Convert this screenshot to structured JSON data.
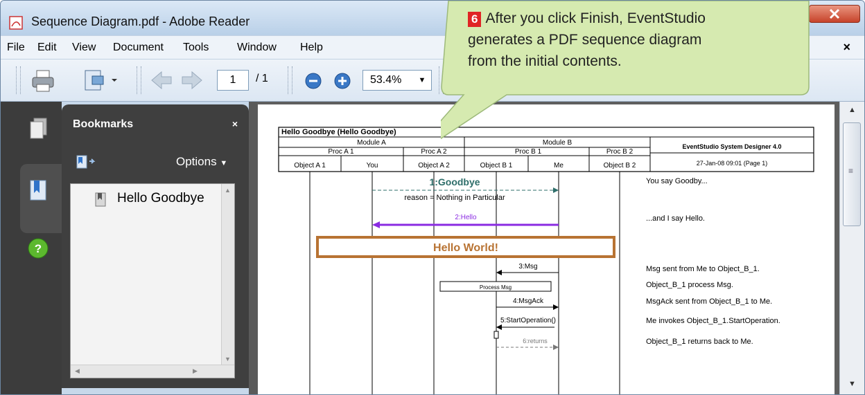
{
  "window": {
    "title": "Sequence Diagram.pdf - Adobe Reader"
  },
  "menu": {
    "items": [
      "File",
      "Edit",
      "View",
      "Document",
      "Tools",
      "Window",
      "Help"
    ],
    "close": "×"
  },
  "toolbar": {
    "page_current": "1",
    "page_total": "/ 1",
    "zoom": "53.4%"
  },
  "bookmarks": {
    "title": "Bookmarks",
    "close": "×",
    "options": "Options",
    "items": [
      "Hello Goodbye"
    ]
  },
  "callout": {
    "step": "6",
    "text": "After you click Finish, EventStudio generates a PDF sequence diagram from the initial contents."
  },
  "diagram": {
    "title": "Hello Goodbye (Hello Goodbye)",
    "modules": [
      "Module A",
      "Module B"
    ],
    "procs": [
      "Proc A 1",
      "Proc A 2",
      "Proc B 1",
      "Proc B 2"
    ],
    "objects": [
      "Object A 1",
      "You",
      "Object A 2",
      "Object B 1",
      "Me",
      "Object B 2"
    ],
    "tool": "EventStudio System Designer 4.0",
    "date": "27-Jan-08 09:01 (Page 1)",
    "messages": {
      "goodbye": "1:Goodbye",
      "reason": "reason = Nothing in Particular",
      "hello": "2:Hello",
      "banner": "Hello World!",
      "msg": "3:Msg",
      "process": "Process Msg",
      "msgack": "4:MsgAck",
      "startop": "5:StartOperation()",
      "returns": "6:returns"
    },
    "remarks": [
      "You say Goodby...",
      "...and I say Hello.",
      "Msg sent from Me to Object_B_1.",
      "Object_B_1 process Msg.",
      "MsgAck sent from Object_B_1 to Me.",
      "Me invokes Object_B_1.StartOperation.",
      "Object_B_1 returns back to Me."
    ]
  },
  "colors": {
    "goodbye": "#2e6e6a",
    "hello": "#8a2be2",
    "banner": "#b87333",
    "callout": "#d6eab0",
    "badge": "#e02424"
  }
}
